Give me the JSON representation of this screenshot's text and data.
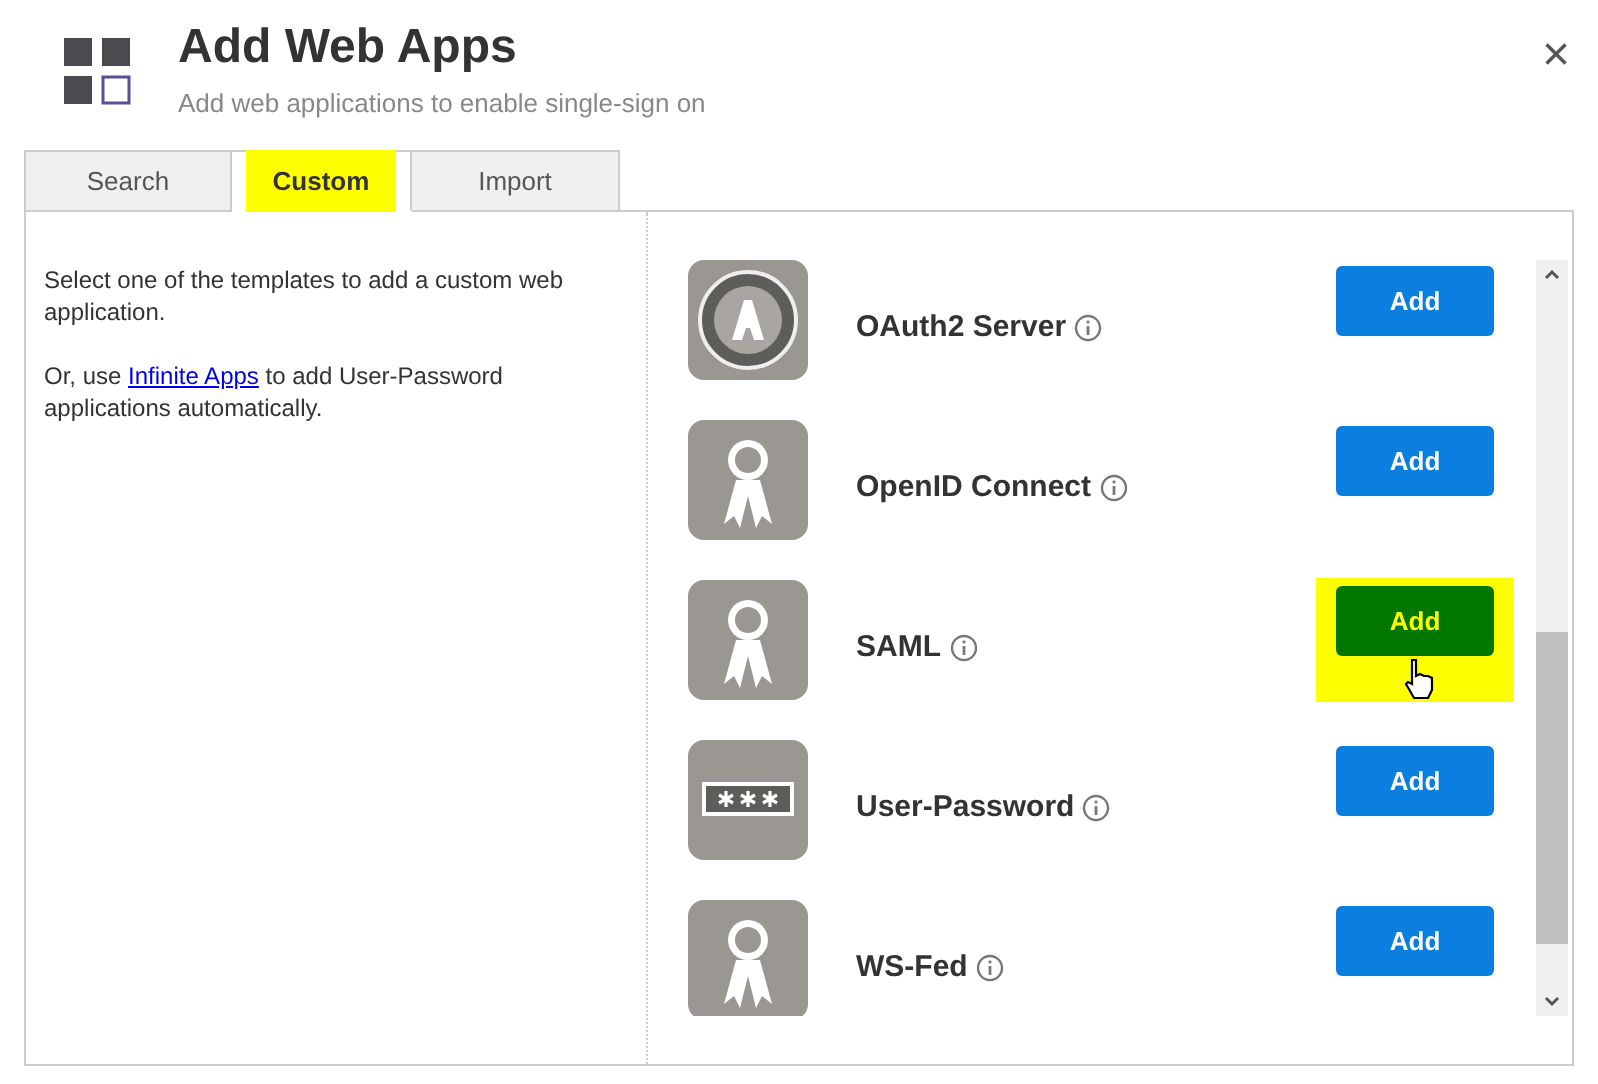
{
  "header": {
    "title": "Add Web Apps",
    "subtitle": "Add web applications to enable single-sign on",
    "close": "×"
  },
  "tabs": [
    {
      "label": "Search",
      "selected": false,
      "highlighted": false
    },
    {
      "label": "Custom",
      "selected": true,
      "highlighted": true
    },
    {
      "label": "Import",
      "selected": false,
      "highlighted": false
    }
  ],
  "info": {
    "text": "Select one of the templates to add a custom web application.",
    "link_before": "Or, use ",
    "link": "Infinite Apps",
    "link_after": " to add User-Password applications automatically."
  },
  "apps": [
    {
      "name": "OAuth2 Server",
      "kind": "oauth",
      "button": "Add",
      "highlighted": false
    },
    {
      "name": "OpenID Connect",
      "kind": "ribbon",
      "button": "Add",
      "highlighted": false
    },
    {
      "name": "SAML",
      "kind": "ribbon",
      "button": "Add",
      "highlighted": true
    },
    {
      "name": "User-Password",
      "kind": "password",
      "button": "Add",
      "highlighted": false
    },
    {
      "name": "WS-Fed",
      "kind": "ribbon",
      "button": "Add",
      "highlighted": false
    }
  ]
}
